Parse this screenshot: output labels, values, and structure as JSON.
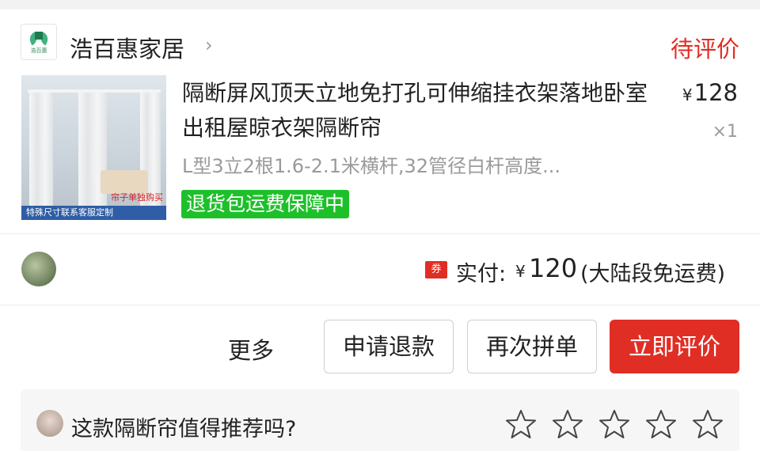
{
  "store": {
    "name": "浩百惠家居",
    "logo_text": "浩百惠",
    "chevron": "›",
    "status": "待评价"
  },
  "product": {
    "title": "隔断屏风顶天立地免打孔可伸缩挂衣架落地卧室出租屋晾衣架隔断帘",
    "price_symbol": "¥",
    "price": "128",
    "quantity": "×1",
    "spec": "L型3立2根1.6-2.1米横杆,32管径白杆高度...",
    "return_badge": "退货包运费保障中",
    "image_caption_red": "帘子单独购买",
    "image_banner": "特殊尺寸联系客服定制"
  },
  "payment": {
    "coupon_icon": "券",
    "label": "实付:",
    "currency": "¥",
    "amount": "120",
    "note": "(大陆段免运费)"
  },
  "actions": {
    "more": "更多",
    "refund": "申请退款",
    "reorder": "再次拼单",
    "review": "立即评价"
  },
  "recommend": {
    "question": "这款隔断帘值得推荐吗?",
    "stars_max": 5,
    "stars_selected": 0
  },
  "colors": {
    "accent_red": "#e02e24",
    "badge_green": "#1ec02a",
    "muted_gray": "#9a9a9a"
  }
}
